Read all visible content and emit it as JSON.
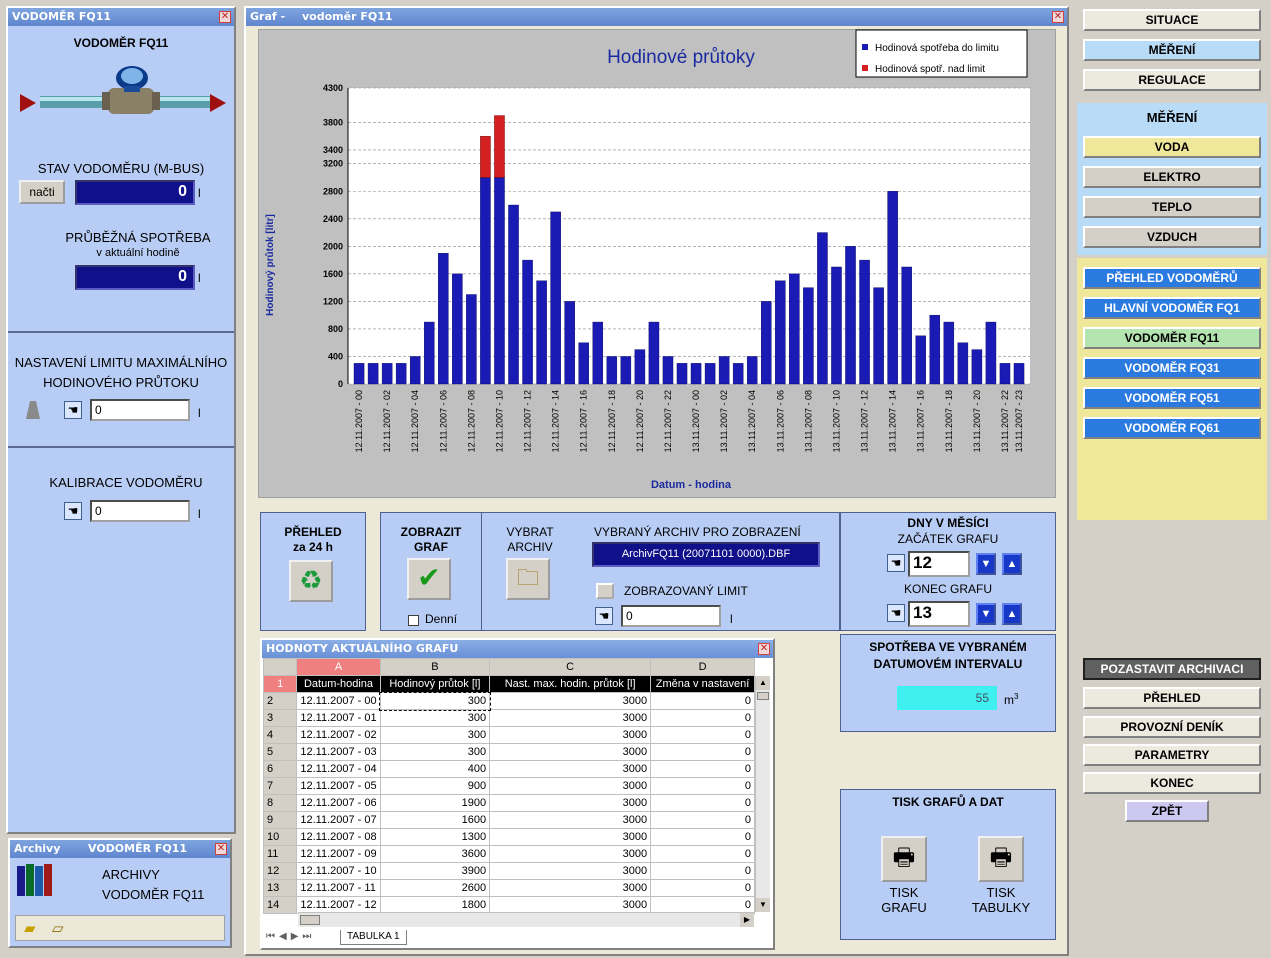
{
  "left_window": {
    "title": "VODOMĚR FQ11",
    "heading": "VODOMĚR FQ11",
    "stav_label": "STAV VODOMĚRU (M-BUS)",
    "nacti_label": "načti",
    "stav_value": "0",
    "stav_unit": "l",
    "prubezna_label": "PRŮBĚŽNÁ SPOTŘEBA",
    "prubezna_sub": "v aktuální hodině",
    "prubezna_value": "0",
    "prubezna_unit": "l",
    "limit_label_1": "NASTAVENÍ LIMITU MAXIMÁLNÍHO",
    "limit_label_2": "HODINOVÉHO PRŮTOKU",
    "limit_value": "0",
    "limit_unit": "l",
    "kalib_label": "KALIBRACE VODOMĚRU",
    "kalib_value": "0",
    "kalib_unit": "l"
  },
  "archive_window": {
    "title_left": "Archivy",
    "title_right": "VODOMĚR  FQ11",
    "label_1": "ARCHIVY",
    "label_2": "VODOMĚR FQ11"
  },
  "graf_window": {
    "title_left": "Graf -",
    "title_right": "vodoměr FQ11"
  },
  "chart_data": {
    "type": "bar",
    "title": "Hodinové průtoky",
    "xlabel": "Datum - hodina",
    "ylabel": "Hodinový průtok [litr]",
    "legend": "top-right",
    "grid": true,
    "ylim": [
      0,
      4300
    ],
    "yticks": [
      "0",
      "400",
      "800",
      "1200",
      "1600",
      "2000",
      "2400",
      "2800",
      "3200",
      "3400",
      "3800",
      "4300"
    ],
    "ytick_values": [
      0,
      400,
      800,
      1200,
      1600,
      2000,
      2400,
      2800,
      3200,
      3400,
      3800,
      4300
    ],
    "categories": [
      "12.11.2007 - 00",
      "12.11.2007 - 01",
      "12.11.2007 - 02",
      "12.11.2007 - 03",
      "12.11.2007 - 04",
      "12.11.2007 - 05",
      "12.11.2007 - 06",
      "12.11.2007 - 07",
      "12.11.2007 - 08",
      "12.11.2007 - 09",
      "12.11.2007 - 10",
      "12.11.2007 - 11",
      "12.11.2007 - 12",
      "12.11.2007 - 13",
      "12.11.2007 - 14",
      "12.11.2007 - 15",
      "12.11.2007 - 16",
      "12.11.2007 - 17",
      "12.11.2007 - 18",
      "12.11.2007 - 19",
      "12.11.2007 - 20",
      "12.11.2007 - 21",
      "12.11.2007 - 22",
      "12.11.2007 - 23",
      "13.11.2007 - 00",
      "13.11.2007 - 01",
      "13.11.2007 - 02",
      "13.11.2007 - 03",
      "13.11.2007 - 04",
      "13.11.2007 - 05",
      "13.11.2007 - 06",
      "13.11.2007 - 07",
      "13.11.2007 - 08",
      "13.11.2007 - 09",
      "13.11.2007 - 10",
      "13.11.2007 - 11",
      "13.11.2007 - 12",
      "13.11.2007 - 13",
      "13.11.2007 - 14",
      "13.11.2007 - 15",
      "13.11.2007 - 16",
      "13.11.2007 - 17",
      "13.11.2007 - 18",
      "13.11.2007 - 19",
      "13.11.2007 - 20",
      "13.11.2007 - 21",
      "13.11.2007 - 22",
      "13.11.2007 - 23"
    ],
    "xtick_labels_shown": [
      "12.11.2007 - 00",
      "12.11.2007 - 02",
      "12.11.2007 - 04",
      "12.11.2007 - 06",
      "12.11.2007 - 08",
      "12.11.2007 - 10",
      "12.11.2007 - 12",
      "12.11.2007 - 14",
      "12.11.2007 - 16",
      "12.11.2007 - 18",
      "12.11.2007 - 20",
      "12.11.2007 - 22",
      "13.11.2007 - 00",
      "13.11.2007 - 02",
      "13.11.2007 - 04",
      "13.11.2007 - 06",
      "13.11.2007 - 08",
      "13.11.2007 - 10",
      "13.11.2007 - 12",
      "13.11.2007 - 14",
      "13.11.2007 - 16",
      "13.11.2007 - 18",
      "13.11.2007 - 20",
      "13.11.2007 - 22",
      "13.11.2007 - 23"
    ],
    "series": [
      {
        "name": "Hodinová spotřeba do limitu",
        "color": "#1a1ab4",
        "values": [
          300,
          300,
          300,
          300,
          400,
          900,
          1900,
          1600,
          1300,
          3000,
          3000,
          2600,
          1800,
          1500,
          2500,
          1200,
          600,
          900,
          400,
          400,
          500,
          900,
          400,
          300,
          300,
          300,
          400,
          300,
          400,
          1200,
          1500,
          1600,
          1400,
          2200,
          1700,
          2000,
          1800,
          1400,
          2800,
          1700,
          700,
          1000,
          900,
          600,
          500,
          900,
          300,
          300
        ]
      },
      {
        "name": "Hodinová spotř. nad limit",
        "color": "#d42020",
        "values": [
          0,
          0,
          0,
          0,
          0,
          0,
          0,
          0,
          0,
          600,
          900,
          0,
          0,
          0,
          0,
          0,
          0,
          0,
          0,
          0,
          0,
          0,
          0,
          0,
          0,
          0,
          0,
          0,
          0,
          0,
          0,
          0,
          0,
          0,
          0,
          0,
          0,
          0,
          0,
          0,
          0,
          0,
          0,
          0,
          0,
          0,
          0,
          0
        ]
      }
    ]
  },
  "controls": {
    "prehled_1": "PŘEHLED",
    "prehled_2": "za 24 h",
    "zobrazit_1": "ZOBRAZIT",
    "zobrazit_2": "GRAF",
    "denni_label": "Denní",
    "vybrat_1": "VYBRAT",
    "vybrat_2": "ARCHIV",
    "archiv_label": "VYBRANÝ ARCHIV PRO ZOBRAZENÍ",
    "archiv_value": "ArchivFQ11 (20071101 0000).DBF",
    "limit_label": "ZOBRAZOVANÝ LIMIT",
    "limit_value": "0",
    "limit_unit": "l",
    "dny_label": "DNY V MĚSÍCI",
    "zacatek_label": "ZAČÁTEK GRAFU",
    "zacatek_value": "12",
    "konec_label": "KONEC GRAFU",
    "konec_value": "13",
    "spotreba_1": "SPOTŘEBA VE VYBRANÉM",
    "spotreba_2": "DATUMOVÉM INTERVALU",
    "spotreba_value": "55",
    "spotreba_unit": "m",
    "spotreba_unit_exp": "3",
    "tisk_label": "TISK GRAFŮ A DAT",
    "tisk_grafu_1": "TISK",
    "tisk_grafu_2": "GRAFU",
    "tisk_tabulky_1": "TISK",
    "tisk_tabulky_2": "TABULKY"
  },
  "table": {
    "title": "HODNOTY AKTUÁLNÍHO GRAFU",
    "col_letters": [
      "A",
      "B",
      "C",
      "D"
    ],
    "headers": [
      "Datum-hodina",
      "Hodinový průtok [l]",
      "Nast. max. hodin. průtok [l]",
      "Změna v nastavení"
    ],
    "rows": [
      [
        "2",
        "12.11.2007 - 00",
        "300",
        "3000",
        "0"
      ],
      [
        "3",
        "12.11.2007 - 01",
        "300",
        "3000",
        "0"
      ],
      [
        "4",
        "12.11.2007 - 02",
        "300",
        "3000",
        "0"
      ],
      [
        "5",
        "12.11.2007 - 03",
        "300",
        "3000",
        "0"
      ],
      [
        "6",
        "12.11.2007 - 04",
        "400",
        "3000",
        "0"
      ],
      [
        "7",
        "12.11.2007 - 05",
        "900",
        "3000",
        "0"
      ],
      [
        "8",
        "12.11.2007 - 06",
        "1900",
        "3000",
        "0"
      ],
      [
        "9",
        "12.11.2007 - 07",
        "1600",
        "3000",
        "0"
      ],
      [
        "10",
        "12.11.2007 - 08",
        "1300",
        "3000",
        "0"
      ],
      [
        "11",
        "12.11.2007 - 09",
        "3600",
        "3000",
        "0"
      ],
      [
        "12",
        "12.11.2007 - 10",
        "3900",
        "3000",
        "0"
      ],
      [
        "13",
        "12.11.2007 - 11",
        "2600",
        "3000",
        "0"
      ],
      [
        "14",
        "12.11.2007 - 12",
        "1800",
        "3000",
        "0"
      ]
    ],
    "header_row_num": "1",
    "sheet_tab": "TABULKA 1"
  },
  "nav": {
    "top": [
      "SITUACE",
      "MĚŘENÍ",
      "REGULACE"
    ],
    "section_title": "MĚŘENÍ",
    "section": [
      "VODA",
      "ELEKTRO",
      "TEPLO",
      "VZDUCH"
    ],
    "meters": [
      "PŘEHLED VODOMĚRŮ",
      "HLAVNÍ VODOMĚR FQ1",
      "VODOMĚR FQ11",
      "VODOMĚR FQ31",
      "VODOMĚR FQ51",
      "VODOMĚR FQ61"
    ],
    "bottom": [
      "POZASTAVIT ARCHIVACI",
      "PŘEHLED",
      "PROVOZNÍ DENÍK",
      "PARAMETRY",
      "KONEC"
    ],
    "back": "ZPĚT"
  }
}
